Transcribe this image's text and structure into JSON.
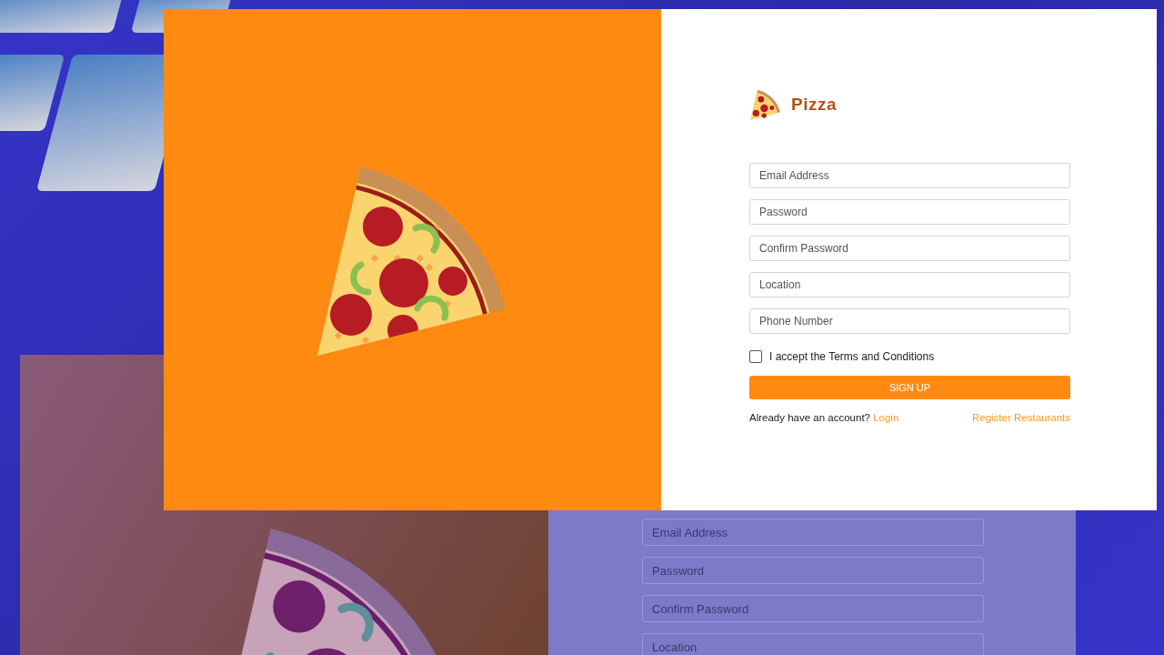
{
  "front": {
    "brand": "Pizza",
    "fields": [
      {
        "placeholder": "Email Address"
      },
      {
        "placeholder": "Password"
      },
      {
        "placeholder": "Confirm Password"
      },
      {
        "placeholder": "Location"
      },
      {
        "placeholder": "Phone Number"
      }
    ],
    "terms": {
      "label": "I accept the Terms and Conditions",
      "checked": false
    },
    "submit": "SIGN UP",
    "footer": {
      "prompt": "Already have an account?",
      "login": "Login",
      "register": "Register Restaurants"
    }
  },
  "back": {
    "fields": [
      {
        "placeholder": "Email Address"
      },
      {
        "placeholder": "Password"
      },
      {
        "placeholder": "Confirm Password"
      },
      {
        "placeholder": "Location"
      }
    ]
  }
}
